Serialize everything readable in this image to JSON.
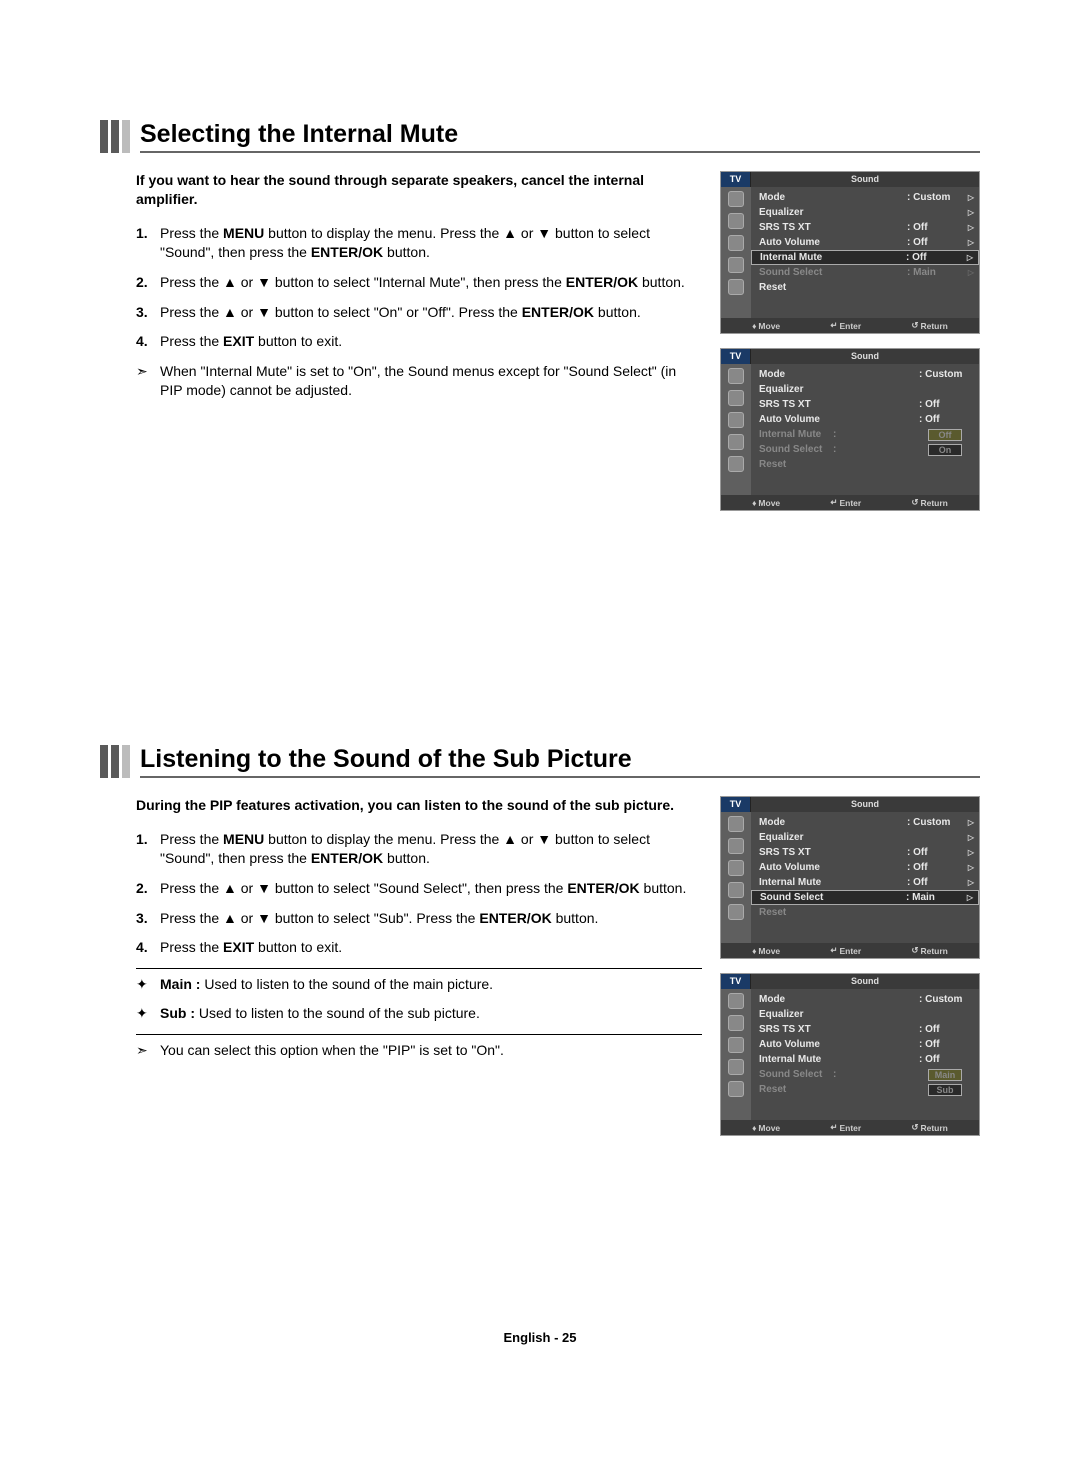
{
  "section1": {
    "title": "Selecting the Internal Mute",
    "intro": "If you want to hear the sound through separate speakers, cancel the internal amplifier.",
    "steps": [
      "Press the <b>MENU</b> button to display the menu. Press the ▲ or ▼ button to select \"Sound\", then press the <b>ENTER/OK</b> button.",
      "Press the ▲ or ▼ button to select \"Internal Mute\", then press the <b>ENTER/OK</b> button.",
      "Press the ▲ or ▼ button to select \"On\" or \"Off\". Press the <b>ENTER/OK</b> button.",
      "Press the <b>EXIT</b> button to exit."
    ],
    "note": "When \"Internal Mute\" is set to \"On\", the Sound menus except for \"Sound Select\" (in PIP mode) cannot be adjusted."
  },
  "section2": {
    "title": "Listening to the Sound of the Sub Picture",
    "intro": "During the PIP features activation, you can listen to the sound of the sub picture.",
    "steps": [
      "Press the <b>MENU</b> button to display the menu. Press the ▲ or ▼ button to select \"Sound\", then press the <b>ENTER/OK</b> button.",
      "Press the ▲ or ▼ button to select \"Sound Select\", then press the <b>ENTER/OK</b> button.",
      "Press the ▲ or ▼ button to select \"Sub\". Press the <b>ENTER/OK</b> button.",
      "Press the <b>EXIT</b> button to exit."
    ],
    "bullets": [
      {
        "label": "Main :",
        "text": "Used to listen to the sound of the main picture."
      },
      {
        "label": "Sub :",
        "text": "Used to listen to the sound of the sub picture."
      }
    ],
    "note": "You can select this option when the \"PIP\" is set to \"On\"."
  },
  "osd": {
    "tv": "TV",
    "menuTitle": "Sound",
    "items": {
      "mode": "Mode",
      "equalizer": "Equalizer",
      "srs": "SRS TS XT",
      "autoVolume": "Auto Volume",
      "internalMute": "Internal Mute",
      "soundSelect": "Sound Select",
      "reset": "Reset"
    },
    "values": {
      "custom": ": Custom",
      "off": ": Off",
      "main": ": Main",
      "colon": ":"
    },
    "opts": {
      "off": "Off",
      "on": "On",
      "main": "Main",
      "sub": "Sub"
    },
    "footer": {
      "move": "Move",
      "enter": "Enter",
      "return": "Return"
    }
  },
  "footer": "English - 25"
}
